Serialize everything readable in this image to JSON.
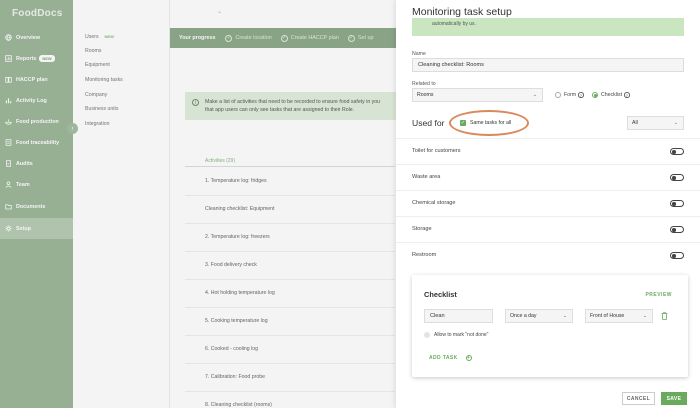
{
  "app": {
    "logo": "FoodDocs"
  },
  "sidebar": {
    "items": [
      {
        "label": "Overview",
        "icon": "globe-icon"
      },
      {
        "label": "Reports",
        "icon": "chart-icon",
        "badge": "NEW"
      },
      {
        "label": "HACCP plan",
        "icon": "book-icon"
      },
      {
        "label": "Activity Log",
        "icon": "bar-chart-icon"
      },
      {
        "label": "Food production",
        "icon": "food-icon"
      },
      {
        "label": "Food traceability",
        "icon": "traceability-icon"
      },
      {
        "label": "Audits",
        "icon": "audit-icon"
      },
      {
        "label": "Team",
        "icon": "person-icon"
      },
      {
        "label": "Documents",
        "icon": "folder-icon"
      },
      {
        "label": "Setup",
        "icon": "gear-icon"
      }
    ]
  },
  "submenu": {
    "items": [
      {
        "label": "Users",
        "badge": "NEW"
      },
      {
        "label": "Rooms"
      },
      {
        "label": "Equipment"
      },
      {
        "label": "Monitoring tasks"
      },
      {
        "label": "Company"
      },
      {
        "label": "Business units"
      },
      {
        "label": "Integration"
      }
    ]
  },
  "progress": {
    "title": "Your progress",
    "steps": [
      "Create location",
      "Create HACCP plan",
      "Set up"
    ]
  },
  "info": {
    "line1": "Make a list of activities that need to be recorded to ensure food safety in you",
    "line2": "that app users can only see tasks that are assigned to their Role."
  },
  "activities": {
    "header": "Activities (29)",
    "items": [
      "1. Temperature log: fridges",
      "Cleaning checklist: Equipment",
      "2. Temperature log: freezers",
      "3. Food delivery check",
      "4. Hot holding temperature log",
      "5. Cooking temperature log",
      "6. Cooked - cooling log",
      "7. Calibration: Food probe",
      "8. Cleaning checklist (rooms)"
    ]
  },
  "panel": {
    "title": "Monitoring task setup",
    "note": "automatically by us.",
    "name_label": "Name",
    "name_value": "Cleaning checklist: Rooms",
    "related_label": "Related to",
    "related_value": "Rooms",
    "form_label": "Form",
    "checklist_label": "Checklist",
    "used_for": "Used for",
    "same_tasks": "Same tasks for all",
    "used_for_select": "All",
    "rooms": [
      {
        "name": "Toilet for customers",
        "enabled": false
      },
      {
        "name": "Waste area",
        "enabled": false
      },
      {
        "name": "Chemical storage",
        "enabled": false
      },
      {
        "name": "Storage",
        "enabled": false
      },
      {
        "name": "Restroom",
        "enabled": false
      }
    ]
  },
  "checklist": {
    "title": "Checklist",
    "preview": "PREVIEW",
    "task_value": "Clean",
    "frequency": "Once a day",
    "role": "Front of House",
    "allow_not_done": "Allow to mark \"not done\"",
    "add_task": "ADD TASK"
  },
  "footer": {
    "cancel": "CANCEL",
    "save": "SAVE"
  },
  "colors": {
    "sidebar": "#9db79a",
    "accent": "#6aaa5f",
    "highlight_oval": "#d9895a"
  }
}
